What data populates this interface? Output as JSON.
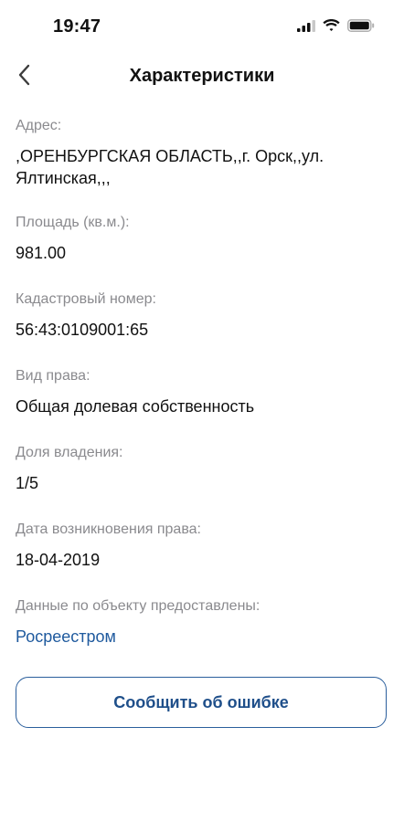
{
  "status_bar": {
    "time": "19:47"
  },
  "nav": {
    "title": "Характеристики"
  },
  "fields": {
    "address": {
      "label": "Адрес:",
      "value": ",ОРЕНБУРГСКАЯ ОБЛАСТЬ,,г. Орск,,ул. Ялтинская,,,"
    },
    "area": {
      "label": "Площадь (кв.м.):",
      "value": "981.00"
    },
    "cadastral": {
      "label": "Кадастровый номер:",
      "value": "56:43:0109001:65"
    },
    "right_type": {
      "label": "Вид права:",
      "value": "Общая долевая собственность"
    },
    "share": {
      "label": "Доля владения:",
      "value": "1/5"
    },
    "right_date": {
      "label": "Дата возникновения права:",
      "value": "18-04-2019"
    },
    "source": {
      "label": "Данные по объекту предоставлены:",
      "value": "Росреестром"
    }
  },
  "actions": {
    "report_label": "Сообщить об ошибке"
  },
  "colors": {
    "link": "#1f5a9e",
    "label": "#8a8a8e",
    "button_border": "#2a5e9c"
  },
  "icons": {
    "back": "chevron-left-icon",
    "signal": "cellular-signal-icon",
    "wifi": "wifi-icon",
    "battery": "battery-icon"
  }
}
